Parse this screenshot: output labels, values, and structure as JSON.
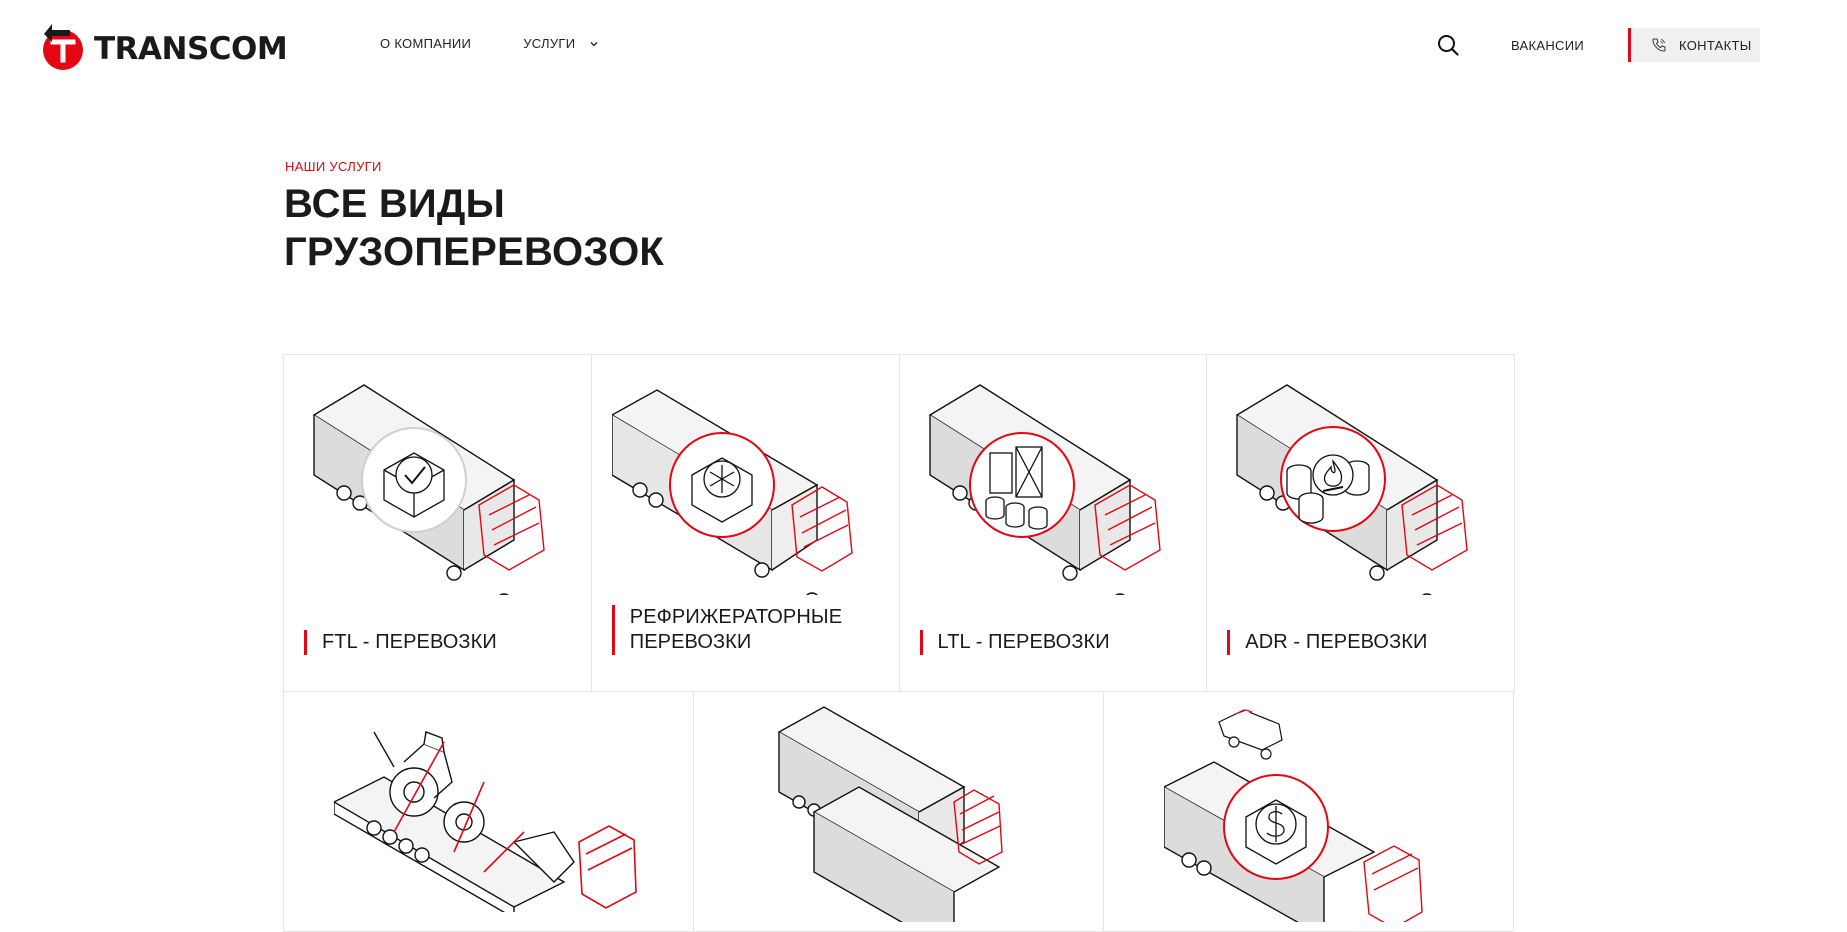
{
  "brand": {
    "name": "TRANSCOM"
  },
  "nav": {
    "about": "О КОМПАНИИ",
    "services": "УСЛУГИ",
    "vacancies": "ВАКАНСИИ",
    "contacts": "КОНТАКТЫ"
  },
  "hero": {
    "kicker": "НАШИ УСЛУГИ",
    "title_line1": "ВСЕ ВИДЫ",
    "title_line2": "ГРУЗОПЕРЕВОЗОК"
  },
  "services": [
    {
      "label": "FTL - ПЕРЕВОЗКИ",
      "icon": "checkmark-box-icon"
    },
    {
      "label_line1": "РЕФРИЖЕРАТОРНЫЕ",
      "label_line2": "ПЕРЕВОЗКИ",
      "icon": "snowflake-icon"
    },
    {
      "label": "LTL - ПЕРЕВОЗКИ",
      "icon": "barrels-crates-icon"
    },
    {
      "label": "ADR - ПЕРЕВОЗКИ",
      "icon": "flame-icon"
    },
    {
      "icon": "heavy-machinery-icon"
    },
    {
      "icon": "truck-convoy-icon"
    },
    {
      "icon": "dollar-escort-icon"
    }
  ],
  "colors": {
    "accent": "#e30613",
    "text": "#1a1a1a",
    "border": "#e6e6e6",
    "contacts_bg": "#f0f0f0"
  }
}
